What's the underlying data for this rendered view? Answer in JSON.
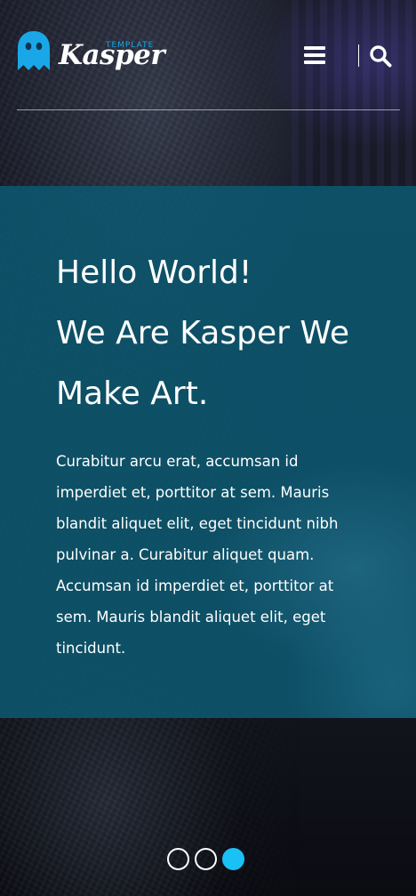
{
  "brand": {
    "name": "Kasper",
    "tag": "TEMPLATE",
    "icon": "ghost-icon",
    "accent_color": "#1aa7e8"
  },
  "nav": {
    "menu_icon": "menu-bars-icon",
    "search_icon": "search-icon"
  },
  "hero": {
    "title_lines": [
      "Hello World!",
      "We Are Kasper We",
      "Make Art."
    ],
    "text": "Curabitur arcu erat, accumsan id imperdiet et, porttitor at sem. Mauris blandit aliquet elit, eget tincidunt nibh pulvinar a. Curabitur aliquet quam. Accumsan id imperdiet et, porttitor at sem. Mauris blandit aliquet elit, eget tincidunt.",
    "box_color": "#0d5870"
  },
  "slider": {
    "bullet_count": 3,
    "active_index": 2,
    "active_color": "#19c1f5"
  }
}
